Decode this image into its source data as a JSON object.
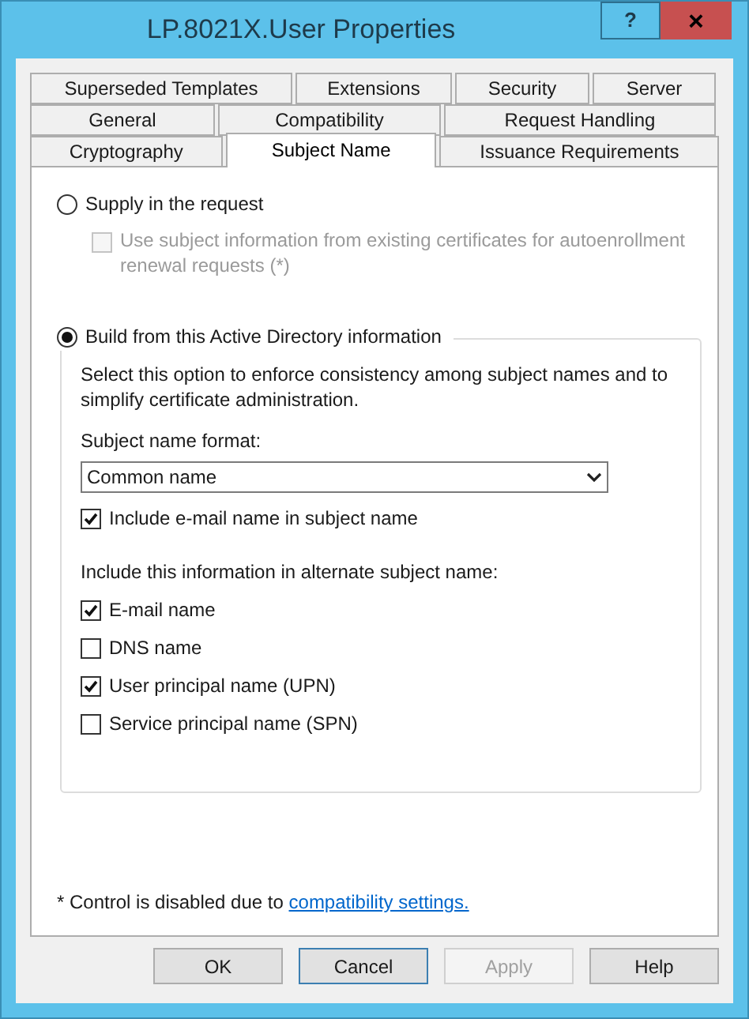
{
  "window": {
    "title": "LP.8021X.User Properties",
    "help_button": "?",
    "close_button": "×"
  },
  "tab_rows": [
    [
      {
        "label": "Superseded Templates",
        "selected": false
      },
      {
        "label": "Extensions",
        "selected": false
      },
      {
        "label": "Security",
        "selected": false
      },
      {
        "label": "Server",
        "selected": false
      }
    ],
    [
      {
        "label": "General",
        "selected": false
      },
      {
        "label": "Compatibility",
        "selected": false
      },
      {
        "label": "Request Handling",
        "selected": false
      }
    ],
    [
      {
        "label": "Cryptography",
        "selected": false
      },
      {
        "label": "Subject Name",
        "selected": true
      },
      {
        "label": "Issuance Requirements",
        "selected": false
      }
    ]
  ],
  "options": [
    {
      "label": "Supply in the request",
      "selected": false,
      "sub_checkbox": {
        "label": "Use subject information from existing certificates for autoenrollment renewal requests (*)",
        "checked": false,
        "disabled": true
      }
    },
    {
      "label": "Build from this Active Directory information",
      "selected": true
    }
  ],
  "group": {
    "description": "Select this option to enforce consistency among subject names and to simplify certificate administration.",
    "format_label": "Subject name format:",
    "format_value": "Common name",
    "include_email": {
      "label": "Include e-mail name in subject name",
      "checked": true
    },
    "alt_label": "Include this information in alternate subject name:",
    "alt_items": [
      {
        "label": "E-mail name",
        "checked": true
      },
      {
        "label": "DNS name",
        "checked": false
      },
      {
        "label": "User principal name (UPN)",
        "checked": true
      },
      {
        "label": "Service principal name (SPN)",
        "checked": false
      }
    ]
  },
  "footnote": {
    "text": "* Control is disabled due to",
    "link": "compatibility settings."
  },
  "buttons": [
    {
      "label": "OK",
      "default": false,
      "disabled": false
    },
    {
      "label": "Cancel",
      "default": true,
      "disabled": false
    },
    {
      "label": "Apply",
      "default": false,
      "disabled": true
    },
    {
      "label": "Help",
      "default": false,
      "disabled": false
    }
  ]
}
